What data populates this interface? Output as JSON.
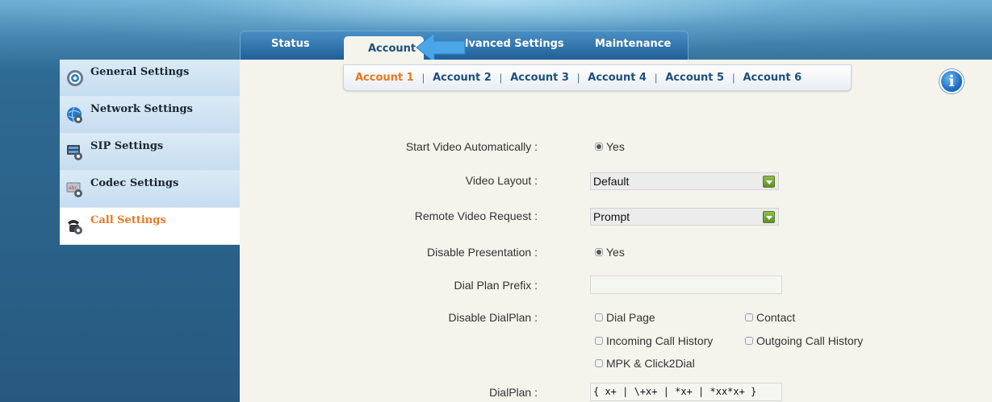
{
  "top_tabs": {
    "status": "Status",
    "account": "Account",
    "advanced": "lvanced Settings",
    "maintenance": "Maintenance"
  },
  "sub_tabs": [
    "Account 1",
    "Account 2",
    "Account 3",
    "Account 4",
    "Account 5",
    "Account 6"
  ],
  "sub_tabs_active": "Account 1",
  "sidebar": {
    "items": [
      {
        "label": "General Settings",
        "icon": "gear-icon"
      },
      {
        "label": "Network Settings",
        "icon": "globe-gear-icon"
      },
      {
        "label": "SIP Settings",
        "icon": "server-gear-icon"
      },
      {
        "label": "Codec Settings",
        "icon": "codec-gear-icon"
      },
      {
        "label": "Call Settings",
        "icon": "phone-gear-icon"
      }
    ],
    "active": "Call Settings"
  },
  "info_glyph": "i",
  "form": {
    "start_video": {
      "label": "Start Video Automatically :",
      "option": "Yes",
      "checked": true
    },
    "video_layout": {
      "label": "Video Layout :",
      "value": "Default"
    },
    "remote_video": {
      "label": "Remote Video Request :",
      "value": "Prompt"
    },
    "disable_presentation": {
      "label": "Disable Presentation :",
      "option": "Yes",
      "checked": true
    },
    "dial_plan_prefix": {
      "label": "Dial Plan Prefix :",
      "value": ""
    },
    "disable_dialplan": {
      "label": "Disable DialPlan :",
      "options": [
        "Dial Page",
        "Contact",
        "Incoming Call History",
        "Outgoing Call History",
        "MPK & Click2Dial"
      ]
    },
    "dialplan": {
      "label": "DialPlan :",
      "value": "{ x+ | \\+x+ | *x+ | *xx*x+ }"
    }
  },
  "colors": {
    "accent_orange": "#e87722",
    "nav_blue": "#1f4e7a",
    "panel_bg": "#f4f3ec",
    "dropdown_green": "#6e9f36"
  }
}
